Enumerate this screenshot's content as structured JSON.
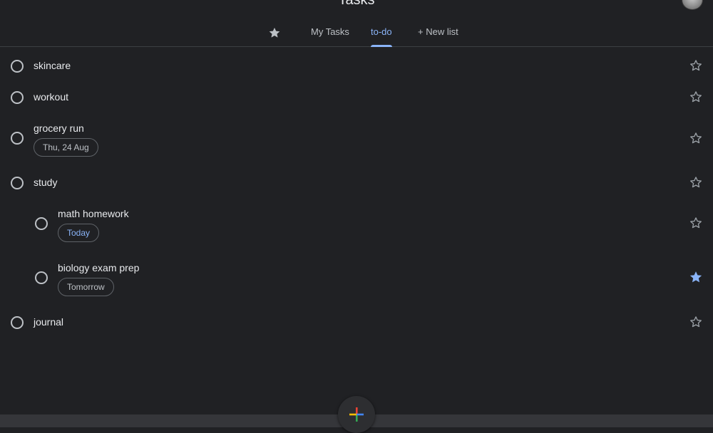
{
  "app": {
    "title": "Tasks"
  },
  "tabs": {
    "starred_icon": "star-icon",
    "my_tasks": "My Tasks",
    "todo": "to-do",
    "new_list": "+ New list",
    "active": "to-do"
  },
  "tasks": [
    {
      "title": "skincare",
      "starred": false
    },
    {
      "title": "workout",
      "starred": false
    },
    {
      "title": "grocery run",
      "date": "Thu, 24 Aug",
      "starred": false
    },
    {
      "title": "study",
      "starred": false
    },
    {
      "title": "math homework",
      "date": "Today",
      "starred": false
    },
    {
      "title": "biology exam prep",
      "date": "Tomorrow",
      "starred": true
    },
    {
      "title": "journal",
      "starred": false
    }
  ],
  "fab": {
    "icon": "add-icon"
  },
  "colors": {
    "background": "#202124",
    "accent": "#8ab4f8",
    "star_active": "#8ab4f8",
    "text": "#e8eaed",
    "muted": "#bdc1c6"
  }
}
